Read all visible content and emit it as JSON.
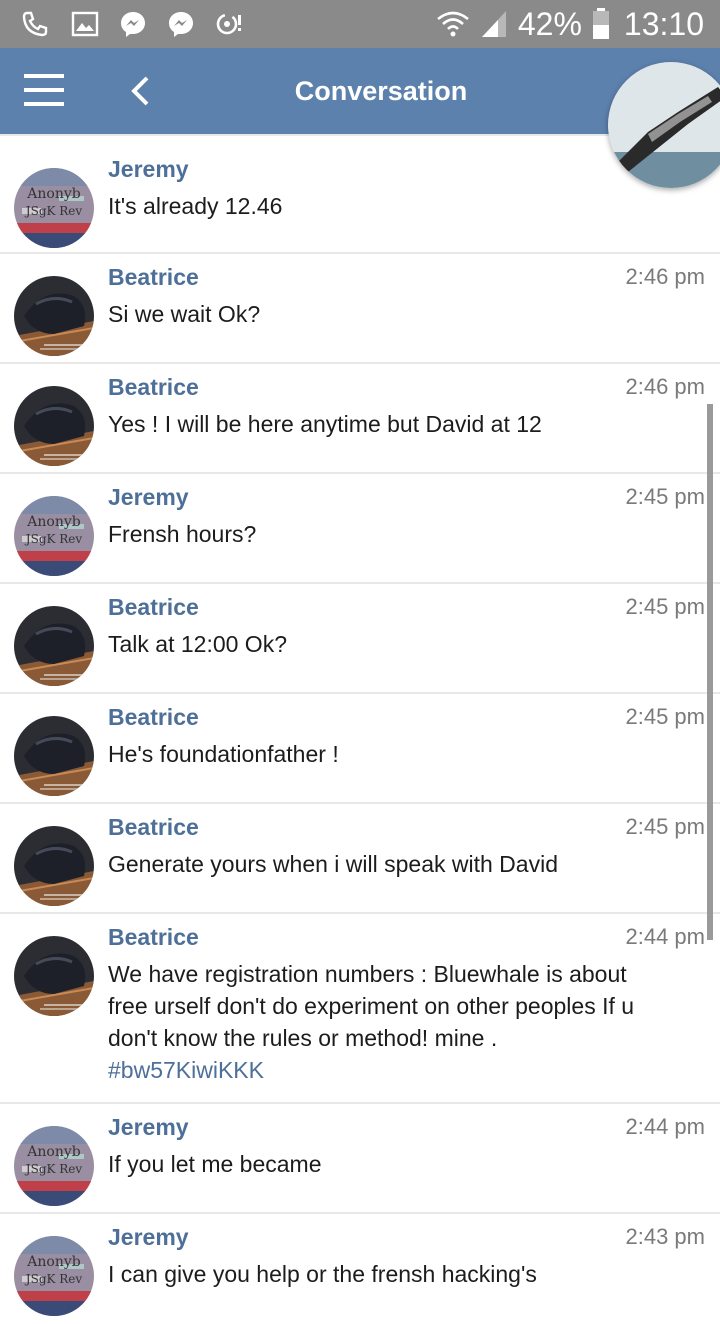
{
  "status_bar": {
    "icons": [
      "phone-icon",
      "image-icon",
      "messenger-icon",
      "messenger-icon",
      "chat-alert-icon"
    ],
    "battery": "42%",
    "time": "13:10"
  },
  "header": {
    "title": "Conversation"
  },
  "messages": [
    {
      "sender": "Jeremy",
      "time": "",
      "text": "It's already 12.46",
      "avatar": "anonymous-avatar"
    },
    {
      "sender": "Beatrice",
      "time": "2:46 pm",
      "text": "Si we wait Ok?",
      "avatar": "dark-avatar"
    },
    {
      "sender": "Beatrice",
      "time": "2:46 pm",
      "text": "Yes ! I will be here anytime but David at 12",
      "avatar": "dark-avatar"
    },
    {
      "sender": "Jeremy",
      "time": "2:45 pm",
      "text": "Frensh hours?",
      "avatar": "anonymous-avatar"
    },
    {
      "sender": "Beatrice",
      "time": "2:45 pm",
      "text": "Talk at 12:00 Ok?",
      "avatar": "dark-avatar"
    },
    {
      "sender": "Beatrice",
      "time": "2:45 pm",
      "text": "He's foundationfather !",
      "avatar": "dark-avatar"
    },
    {
      "sender": "Beatrice",
      "time": "2:45 pm",
      "text": "Generate yours when i will speak with David",
      "avatar": "dark-avatar"
    },
    {
      "sender": "Beatrice",
      "time": "2:44 pm",
      "text": "We have registration numbers : Bluewhale is about free urself don't do experiment on other peoples If u don't know the rules or method! mine .",
      "tag": "#bw57KiwiKKK",
      "avatar": "dark-avatar"
    },
    {
      "sender": "Jeremy",
      "time": "2:44 pm",
      "text": "If you let me became",
      "avatar": "anonymous-avatar"
    },
    {
      "sender": "Jeremy",
      "time": "2:43 pm",
      "text": "I can give you help or the frensh hacking's",
      "avatar": "anonymous-avatar"
    }
  ],
  "avatars": {
    "anonymous": {
      "line1": "Anonyb",
      "line2": "JSgK Rev"
    }
  },
  "colors": {
    "header": "#5d81ad",
    "status_bar": "#8a8a8a",
    "sender": "#4d6f98",
    "tag": "#4d6f98"
  }
}
